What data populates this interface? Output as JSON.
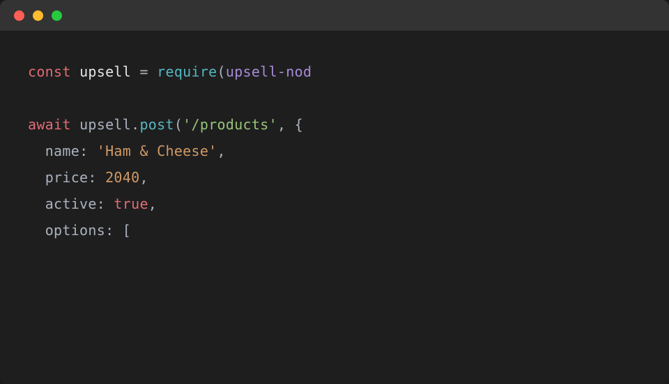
{
  "window": {
    "traffic_lights": [
      "close",
      "minimize",
      "maximize"
    ]
  },
  "code": {
    "line1": {
      "const": "const",
      "ident": "upsell",
      "eq": "=",
      "require": "require",
      "arg": "upsell-nod"
    },
    "line2_blank": "",
    "line3": {
      "await": "await",
      "obj": "upsell",
      "method": "post",
      "path": "'/products'",
      "brace": "{"
    },
    "line4": {
      "indent": "  ",
      "key": "name",
      "value": "'Ham & Cheese'"
    },
    "line5": {
      "indent": "  ",
      "key": "price",
      "value": "2040"
    },
    "line6": {
      "indent": "  ",
      "key": "active",
      "value": "true"
    },
    "line7": {
      "indent": "  ",
      "key": "options",
      "bracket": "["
    }
  },
  "colors": {
    "bg": "#1e1e1e",
    "titlebar": "#333333",
    "keyword": "#e06c75",
    "function": "#56b6c2",
    "string": "#98c379",
    "string_alt": "#d19a66",
    "number": "#d19a66",
    "boolean": "#e06c75",
    "property": "#abb2bf",
    "ident": "#e5e5e5",
    "arg_raw": "#a78bda"
  }
}
